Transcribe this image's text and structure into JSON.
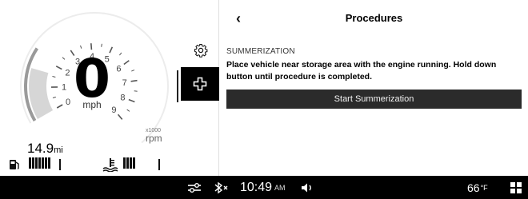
{
  "cluster": {
    "speed": "0",
    "speed_unit": "mph",
    "rpm_ticks": [
      "0",
      "1",
      "2",
      "3",
      "4",
      "5",
      "6",
      "7",
      "8",
      "9"
    ],
    "rpm_scale": "x1000",
    "rpm_label": "rpm",
    "odometer_value": "14.9",
    "odometer_unit": "mi",
    "fuel_level_segments": 7,
    "coolant_temp_segments": 4,
    "colors": {
      "rpm_arc": "#9a9a9a",
      "rpm_fill": "#d6d6d6",
      "gauge_ticks": "#555555"
    }
  },
  "rail": {
    "items": [
      {
        "icon": "gear-icon",
        "active": false
      },
      {
        "icon": "plus-cross-icon",
        "active": true
      }
    ]
  },
  "panel": {
    "back_icon": "‹",
    "title": "Procedures",
    "section_label": "SUMMERIZATION",
    "description": "Place vehicle near storage area with the engine running. Hold down button until procedure is completed.",
    "start_button_label": "Start Summerization"
  },
  "status_bar": {
    "settings_icon": "sliders-icon",
    "bluetooth_icon": "bluetooth-off-icon",
    "time": "10:49",
    "ampm": "AM",
    "volume_icon": "speaker-icon",
    "outside_temp": "66",
    "temp_unit": "°F",
    "apps_icon": "grid-icon"
  }
}
